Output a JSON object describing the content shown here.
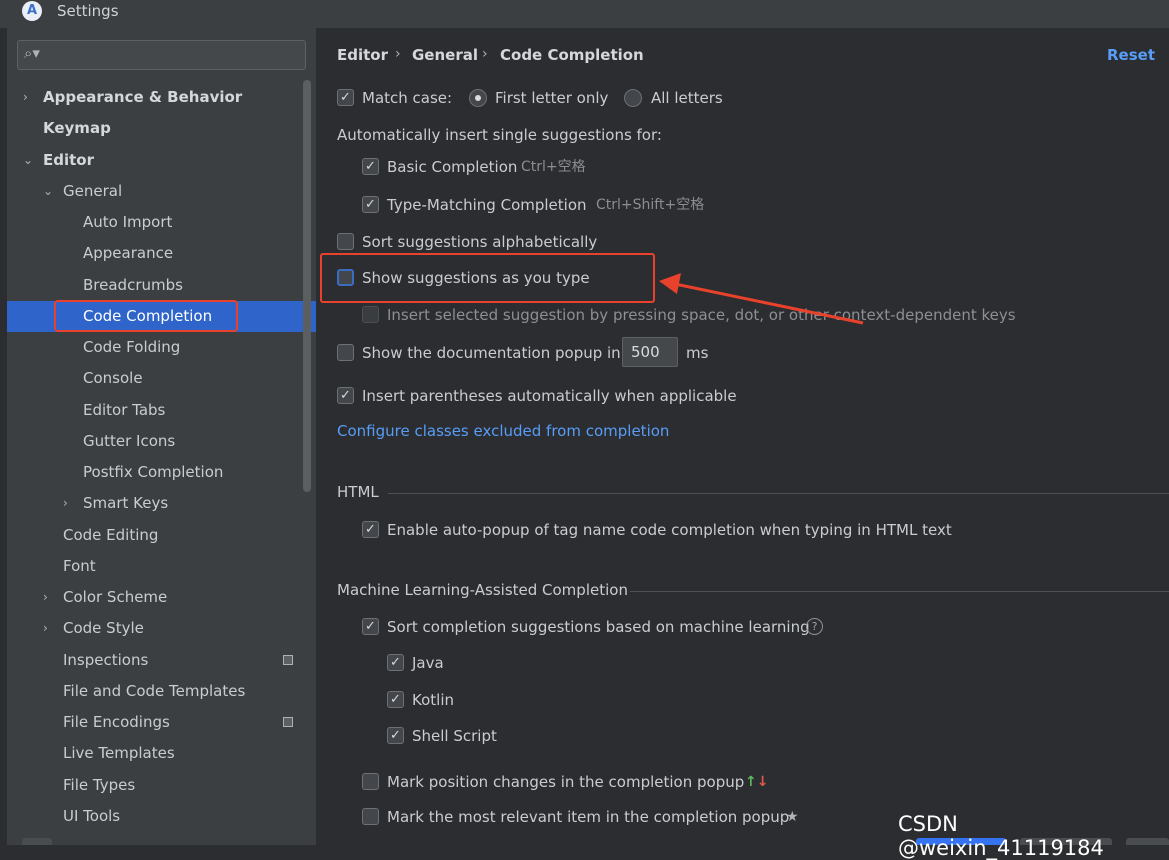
{
  "window": {
    "title": "Settings",
    "app_icon": "android-studio-icon"
  },
  "search": {
    "placeholder": ""
  },
  "sidebar": {
    "items": [
      {
        "label": "Appearance & Behavior",
        "chevron": "›"
      },
      {
        "label": "Keymap"
      },
      {
        "label": "Editor",
        "chevron": "⌄"
      },
      {
        "label": "General",
        "chevron": "⌄"
      },
      {
        "label": "Auto Import"
      },
      {
        "label": "Appearance"
      },
      {
        "label": "Breadcrumbs"
      },
      {
        "label": "Code Completion",
        "selected": true
      },
      {
        "label": "Code Folding"
      },
      {
        "label": "Console"
      },
      {
        "label": "Editor Tabs"
      },
      {
        "label": "Gutter Icons"
      },
      {
        "label": "Postfix Completion"
      },
      {
        "label": "Smart Keys",
        "chevron": "›"
      },
      {
        "label": "Code Editing"
      },
      {
        "label": "Font"
      },
      {
        "label": "Color Scheme",
        "chevron": "›"
      },
      {
        "label": "Code Style",
        "chevron": "›"
      },
      {
        "label": "Inspections"
      },
      {
        "label": "File and Code Templates"
      },
      {
        "label": "File Encodings"
      },
      {
        "label": "Live Templates"
      },
      {
        "label": "File Types"
      },
      {
        "label": "UI Tools"
      }
    ]
  },
  "breadcrumb": {
    "items": [
      "Editor",
      "General",
      "Code Completion"
    ],
    "separator": "›"
  },
  "reset_label": "Reset",
  "content": {
    "match_case": {
      "label": "Match case:",
      "checked": true,
      "options": [
        "First letter only",
        "All letters"
      ],
      "selected": "First letter only"
    },
    "auto_insert_heading": "Automatically insert single suggestions for:",
    "basic_completion": {
      "label": "Basic Completion",
      "shortcut": "Ctrl+空格",
      "checked": true
    },
    "type_matching": {
      "label": "Type-Matching Completion",
      "shortcut": "Ctrl+Shift+空格",
      "checked": true
    },
    "sort_alpha": {
      "label": "Sort suggestions alphabetically",
      "checked": false
    },
    "show_as_type": {
      "label": "Show suggestions as you type",
      "checked": false
    },
    "insert_selected": {
      "label": "Insert selected suggestion by pressing space, dot, or other context-dependent keys",
      "checked": false
    },
    "doc_popup": {
      "label": "Show the documentation popup in",
      "value": "500",
      "unit": "ms",
      "checked": false
    },
    "insert_parens": {
      "label": "Insert parentheses automatically when applicable",
      "checked": true
    },
    "configure_link": "Configure classes excluded from completion",
    "html_section": {
      "title": "HTML",
      "auto_popup": {
        "label": "Enable auto-popup of tag name code completion when typing in HTML text",
        "checked": true
      }
    },
    "ml_section": {
      "title": "Machine Learning-Assisted Completion",
      "sort_ml": {
        "label": "Sort completion suggestions based on machine learning",
        "checked": true
      },
      "languages": [
        {
          "label": "Java",
          "checked": true
        },
        {
          "label": "Kotlin",
          "checked": true
        },
        {
          "label": "Shell Script",
          "checked": true
        }
      ],
      "mark_position": {
        "label": "Mark position changes in the completion popup",
        "checked": false
      },
      "mark_relevant": {
        "label": "Mark the most relevant item in the completion popup",
        "checked": false
      }
    }
  },
  "watermark": "CSDN @weixin_41119184",
  "colors": {
    "accent": "#2f65ca",
    "link": "#589df6",
    "annotation": "#e8412c",
    "background": "#2b2d30",
    "panel": "#3c3f41"
  }
}
